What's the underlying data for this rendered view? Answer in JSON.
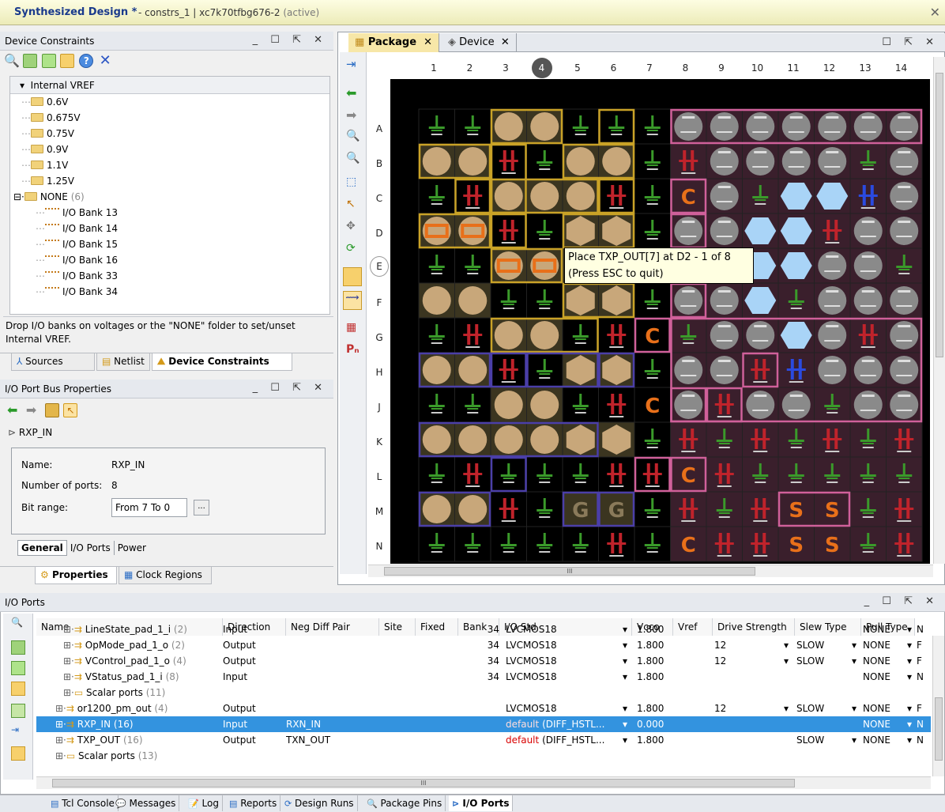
{
  "window": {
    "title": "Synthesized Design *",
    "subtitle": "constrs_1 | xc7k70tfbg676-2",
    "status": "(active)"
  },
  "device_constraints": {
    "panel_title": "Device Constraints",
    "root": "Internal VREF",
    "voltages": [
      "0.6V",
      "0.675V",
      "0.75V",
      "0.9V",
      "1.1V",
      "1.25V"
    ],
    "none_label": "NONE",
    "none_count": "(6)",
    "banks": [
      "I/O Bank 13",
      "I/O Bank 14",
      "I/O Bank 15",
      "I/O Bank 16",
      "I/O Bank 33",
      "I/O Bank 34"
    ],
    "hint": "Drop I/O banks on voltages or the \"NONE\" folder to set/unset Internal VREF.",
    "tabs": [
      "Sources",
      "Netlist",
      "Device Constraints"
    ]
  },
  "bus_props": {
    "panel_title": "I/O Port Bus Properties",
    "port": "RXP_IN",
    "name_label": "Name:",
    "name_value": "RXP_IN",
    "nports_label": "Number of ports:",
    "nports_value": "8",
    "bitrange_label": "Bit range:",
    "bitrange_value": "From 7 To 0",
    "bitrange_btn": "...",
    "subtabs": [
      "General",
      "I/O Ports",
      "Power"
    ],
    "tabs": [
      "Properties",
      "Clock Regions"
    ]
  },
  "package": {
    "tabs": [
      "Package",
      "Device"
    ],
    "cols": [
      "1",
      "2",
      "3",
      "4",
      "5",
      "6",
      "7",
      "8",
      "9",
      "10",
      "11",
      "12",
      "13",
      "14"
    ],
    "rows": [
      "A",
      "B",
      "C",
      "D",
      "E",
      "F",
      "G",
      "H",
      "J",
      "K",
      "L",
      "M",
      "N"
    ],
    "highlight_col": "4",
    "highlight_row": "E",
    "tooltip_line1": "Place TXP_OUT[7] at D2 - 1 of 8",
    "tooltip_line2": "(Press ESC to quit)",
    "hscroll": "III"
  },
  "io_ports": {
    "panel_title": "I/O Ports",
    "columns": [
      "Name",
      "Direction",
      "Neg Diff Pair",
      "Site",
      "Fixed",
      "Bank",
      "I/O Std",
      "Vcco",
      "Vref",
      "Drive Strength",
      "Slew Type",
      "Pull Type"
    ],
    "rows": [
      {
        "name": "LineState_pad_1_i",
        "count": "(2)",
        "dir": "Input",
        "neg": "",
        "bank": "34",
        "std": "LVCMOS18",
        "stdx": "",
        "vcco": "1.800",
        "drive": "",
        "slew": "",
        "pull": "NONE",
        "odt": "N",
        "indent": 2
      },
      {
        "name": "OpMode_pad_1_o",
        "count": "(2)",
        "dir": "Output",
        "neg": "",
        "bank": "34",
        "std": "LVCMOS18",
        "stdx": "",
        "vcco": "1.800",
        "drive": "12",
        "slew": "SLOW",
        "pull": "NONE",
        "odt": "F",
        "indent": 2
      },
      {
        "name": "VControl_pad_1_o",
        "count": "(4)",
        "dir": "Output",
        "neg": "",
        "bank": "34",
        "std": "LVCMOS18",
        "stdx": "",
        "vcco": "1.800",
        "drive": "12",
        "slew": "SLOW",
        "pull": "NONE",
        "odt": "F",
        "indent": 2
      },
      {
        "name": "VStatus_pad_1_i",
        "count": "(8)",
        "dir": "Input",
        "neg": "",
        "bank": "34",
        "std": "LVCMOS18",
        "stdx": "",
        "vcco": "1.800",
        "drive": "",
        "slew": "",
        "pull": "NONE",
        "odt": "N",
        "indent": 2
      },
      {
        "name": "Scalar ports",
        "count": "(11)",
        "dir": "",
        "neg": "",
        "bank": "",
        "std": "",
        "stdx": "",
        "vcco": "",
        "drive": "",
        "slew": "",
        "pull": "",
        "odt": "",
        "indent": 2
      },
      {
        "name": "or1200_pm_out",
        "count": "(4)",
        "dir": "Output",
        "neg": "",
        "bank": "",
        "std": "LVCMOS18",
        "stdx": "",
        "vcco": "1.800",
        "drive": "12",
        "slew": "SLOW",
        "pull": "NONE",
        "odt": "F",
        "indent": 1
      },
      {
        "name": "RXP_IN",
        "count": "(16)",
        "dir": "Input",
        "neg": "RXN_IN",
        "bank": "",
        "std": "default",
        "stdx": "(DIFF_HSTL...",
        "vcco": "0.000",
        "drive": "",
        "slew": "",
        "pull": "NONE",
        "odt": "N",
        "indent": 1
      },
      {
        "name": "TXP_OUT",
        "count": "(16)",
        "dir": "Output",
        "neg": "TXN_OUT",
        "bank": "",
        "std": "default",
        "stdx": "(DIFF_HSTL...",
        "vcco": "1.800",
        "drive": "",
        "slew": "SLOW",
        "pull": "NONE",
        "odt": "N",
        "indent": 1
      },
      {
        "name": "Scalar ports",
        "count": "(13)",
        "dir": "",
        "neg": "",
        "bank": "",
        "std": "",
        "stdx": "",
        "vcco": "",
        "drive": "",
        "slew": "",
        "pull": "",
        "odt": "",
        "indent": 1
      }
    ],
    "hscroll": "III"
  },
  "bottom_tabs": [
    "Tcl Console",
    "Messages",
    "Log",
    "Reports",
    "Design Runs",
    "Package Pins",
    "I/O Ports"
  ],
  "colors": {
    "accent": "#3393df",
    "title_bg": "#f4f3c8",
    "gold": "#c9a227",
    "purple": "#4b3fa8",
    "pink": "#d0609a"
  },
  "package_cells": "CELLS_PLACEHOLDER"
}
